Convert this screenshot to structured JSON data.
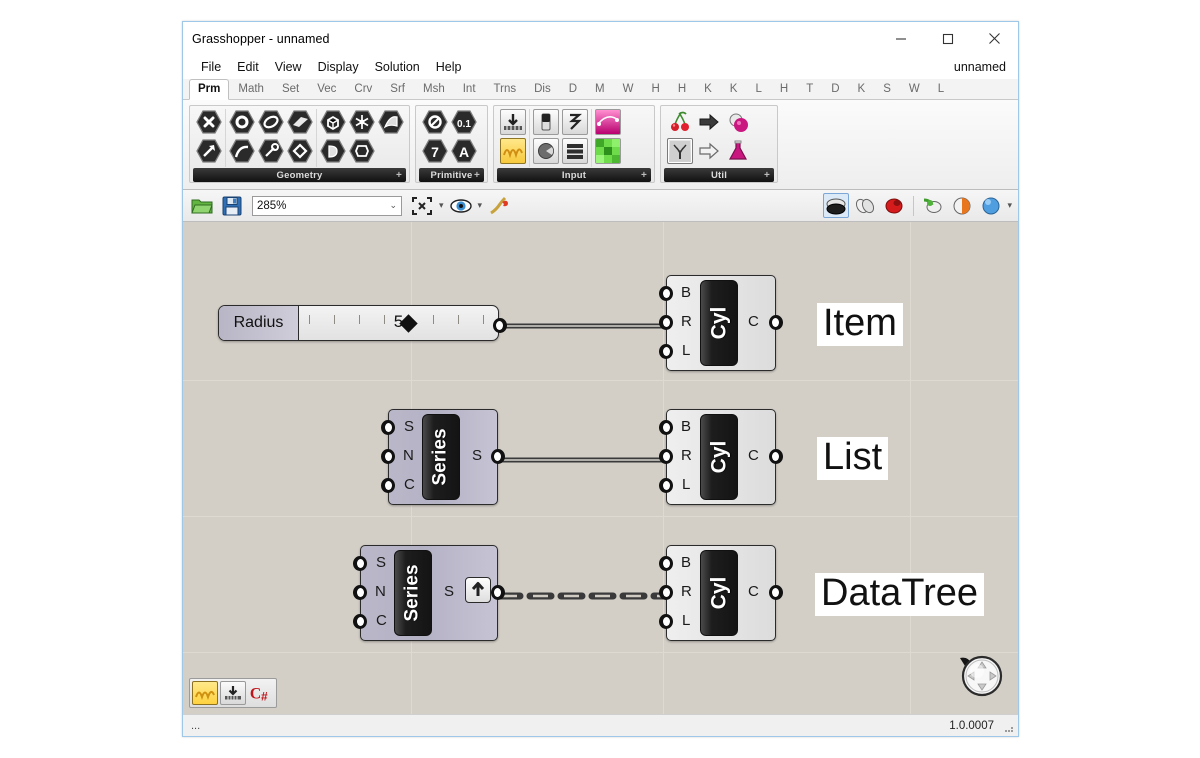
{
  "window": {
    "title": "Grasshopper - unnamed",
    "minimize_label": "minimize-icon",
    "maximize_label": "maximize-icon",
    "close_label": "close-icon"
  },
  "menu": {
    "items": [
      "File",
      "Edit",
      "View",
      "Display",
      "Solution",
      "Help"
    ],
    "document_name": "unnamed"
  },
  "tabs": {
    "active": "Prm",
    "items": [
      "Prm",
      "Math",
      "Set",
      "Vec",
      "Crv",
      "Srf",
      "Msh",
      "Int",
      "Trns",
      "Dis",
      "D",
      "M",
      "W",
      "H",
      "H",
      "K",
      "K",
      "L",
      "H",
      "T",
      "D",
      "K",
      "S",
      "W",
      "L"
    ]
  },
  "ribbon": {
    "groups": [
      {
        "label": "Geometry",
        "expand": "+",
        "sections": [
          {
            "row1": [
              "geometry-param-icon"
            ],
            "row2": [
              "vector-param-icon"
            ]
          },
          {
            "row1": [
              "point-param-icon",
              "circle-param-icon",
              "plane-param-icon"
            ],
            "row2": [
              "curve-param-icon",
              "arc-param-icon",
              "line-param-icon"
            ]
          },
          {
            "row1": [
              "box-param-icon",
              "mesh-param-icon",
              "surface-param-icon"
            ],
            "row2": [
              "brep-param-icon",
              "subd-param-icon"
            ]
          }
        ]
      },
      {
        "label": "Primitive",
        "expand": "+",
        "sections": [
          {
            "row1": [
              "boolean-param-icon",
              "number-param-icon"
            ],
            "row2": [
              "integer-param-icon",
              "text-param-icon"
            ]
          }
        ]
      },
      {
        "label": "Input",
        "expand": "+",
        "sections": [
          {
            "row1": [
              "number-slider-icon"
            ],
            "row2": [
              "gradient-icon"
            ]
          },
          {
            "row1": [
              "boolean-toggle-icon",
              "value-list-icon"
            ],
            "row2": [
              "knob-icon",
              "panel-icon"
            ]
          },
          {
            "row1": [
              "graph-mapper-icon"
            ],
            "row2": [
              "color-swatch-icon"
            ]
          }
        ]
      },
      {
        "label": "Util",
        "expand": "+",
        "sections": [
          {
            "row1": [
              "cherry-icon",
              "arrow-solid-icon",
              "sphere-pink-icon"
            ],
            "row2": [
              "tree-icon",
              "arrow-hollow-icon",
              "flask-icon"
            ]
          }
        ]
      }
    ]
  },
  "canvas_toolbar": {
    "open_label": "open-file-icon",
    "save_label": "save-file-icon",
    "zoom_value": "285%",
    "zoom_dropdown_caret": "⌄",
    "zoom_extents_label": "zoom-extents-icon",
    "preview_label": "preview-eye-icon",
    "sketch_label": "sketch-flame-icon",
    "right_icons": [
      "shaded-preview-icon",
      "wireframe-preview-icon",
      "render-preview-icon",
      "preview-off-icon",
      "preview-mesh-icon",
      "preview-settings-icon"
    ]
  },
  "canvas": {
    "components": [
      {
        "id": "radius-slider",
        "type": "number-slider",
        "name": "Radius",
        "value": "5",
        "selected": false
      },
      {
        "id": "cyl-item",
        "type": "component",
        "name": "Cyl",
        "inputs": [
          "B",
          "R",
          "L"
        ],
        "outputs": [
          "C"
        ],
        "selected": false
      },
      {
        "id": "series-list",
        "type": "component",
        "name": "Series",
        "inputs": [
          "S",
          "N",
          "C"
        ],
        "outputs": [
          "S"
        ],
        "selected": true
      },
      {
        "id": "cyl-list",
        "type": "component",
        "name": "Cyl",
        "inputs": [
          "B",
          "R",
          "L"
        ],
        "outputs": [
          "C"
        ],
        "selected": false
      },
      {
        "id": "series-datatree",
        "type": "component",
        "name": "Series",
        "inputs": [
          "S",
          "N",
          "C"
        ],
        "outputs": [
          "S"
        ],
        "selected": true,
        "modifier": "graft-icon"
      },
      {
        "id": "cyl-datatree",
        "type": "component",
        "name": "Cyl",
        "inputs": [
          "B",
          "R",
          "L"
        ],
        "outputs": [
          "C"
        ],
        "selected": false
      }
    ],
    "labels": [
      {
        "id": "label-item",
        "text": "Item"
      },
      {
        "id": "label-list",
        "text": "List"
      },
      {
        "id": "label-datatree",
        "text": "DataTree"
      }
    ],
    "widgets": [
      {
        "name": "gradient-widget-icon",
        "state": "on"
      },
      {
        "name": "profiler-widget-icon",
        "state": "off"
      },
      {
        "name": "csharp-widget-icon",
        "state": "plain"
      }
    ],
    "compass_label": "navigation-compass-icon"
  },
  "statusbar": {
    "left_text": "...",
    "version": "1.0.0007"
  }
}
